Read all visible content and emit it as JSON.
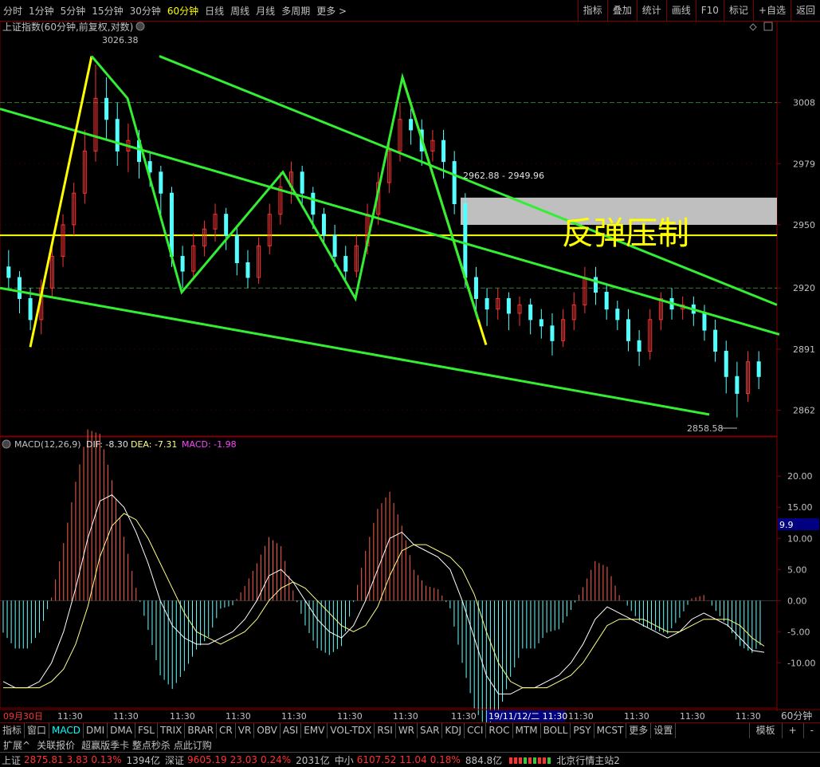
{
  "toolbar": {
    "timeframes": [
      "分时",
      "1分钟",
      "5分钟",
      "15分钟",
      "30分钟",
      "60分钟",
      "日线",
      "周线",
      "月线",
      "多周期",
      "更多 >"
    ],
    "active_timeframe": "60分钟",
    "right_buttons": [
      "指标",
      "叠加",
      "统计",
      "画线",
      "F10",
      "标记",
      "+自选",
      "返回"
    ]
  },
  "chart_title": "上证指数(60分钟,前复权,对数)",
  "annotation": {
    "text": "反弹压制",
    "range_label": "2962.88 - 2949.96",
    "high_label": "3026.38",
    "low_label": "2858.58"
  },
  "price_axis": [
    {
      "label": "3008",
      "value": 3008
    },
    {
      "label": "2979",
      "value": 2979
    },
    {
      "label": "2950",
      "value": 2950
    },
    {
      "label": "2920",
      "value": 2920
    },
    {
      "label": "2891",
      "value": 2891
    },
    {
      "label": "2862",
      "value": 2862
    }
  ],
  "macd": {
    "title": "MACD(12,26,9)",
    "dif_label": "DIF: -8.30",
    "dea_label": "DEA: -7.31",
    "macd_label": "MACD: -1.98",
    "axis": [
      {
        "label": "20.00",
        "value": 20
      },
      {
        "label": "15.00",
        "value": 15
      },
      {
        "label": "10.00",
        "value": 10
      },
      {
        "label": "5.00",
        "value": 5
      },
      {
        "label": "0.00",
        "value": 0
      },
      {
        "label": "-5.00",
        "value": -5
      },
      {
        "label": "-10.00",
        "value": -10
      }
    ],
    "cursor_value": "9.9"
  },
  "time_axis": {
    "labels": [
      "09月30日",
      "11:30",
      "11:30",
      "11:30",
      "11:30",
      "11:30",
      "11:30",
      "11:30",
      "11:30",
      "19/11/12/二 11:30",
      "11:30",
      "11:30",
      "11:30",
      "11:30"
    ],
    "period_label": "60分钟"
  },
  "chart_data": {
    "type": "candlestick",
    "title": "上证指数(60分钟,前复权,对数)",
    "ylim": [
      2852,
      3040
    ],
    "high": 3026.38,
    "low": 2858.58,
    "resistance_zone": [
      2949.96,
      2962.88
    ],
    "horizontal_level": 2945,
    "candles": [
      [
        2930,
        2925,
        2938,
        2920
      ],
      [
        2925,
        2915,
        2928,
        2908
      ],
      [
        2915,
        2905,
        2920,
        2900
      ],
      [
        2905,
        2920,
        2924,
        2898
      ],
      [
        2920,
        2935,
        2940,
        2916
      ],
      [
        2935,
        2950,
        2955,
        2930
      ],
      [
        2950,
        2965,
        2970,
        2945
      ],
      [
        2965,
        2985,
        2995,
        2960
      ],
      [
        2985,
        3010,
        3026,
        2980
      ],
      [
        3010,
        3000,
        3020,
        2990
      ],
      [
        3000,
        2985,
        3008,
        2978
      ],
      [
        2985,
        2990,
        2998,
        2975
      ],
      [
        2990,
        2980,
        2995,
        2972
      ],
      [
        2980,
        2975,
        2985,
        2968
      ],
      [
        2975,
        2965,
        2978,
        2955
      ],
      [
        2965,
        2935,
        2968,
        2930
      ],
      [
        2935,
        2928,
        2940,
        2920
      ],
      [
        2928,
        2940,
        2946,
        2925
      ],
      [
        2940,
        2948,
        2952,
        2935
      ],
      [
        2948,
        2955,
        2960,
        2942
      ],
      [
        2955,
        2945,
        2958,
        2938
      ],
      [
        2945,
        2932,
        2950,
        2926
      ],
      [
        2932,
        2925,
        2938,
        2920
      ],
      [
        2925,
        2940,
        2944,
        2922
      ],
      [
        2940,
        2955,
        2960,
        2936
      ],
      [
        2955,
        2968,
        2975,
        2950
      ],
      [
        2968,
        2975,
        2980,
        2960
      ],
      [
        2975,
        2965,
        2978,
        2958
      ],
      [
        2965,
        2955,
        2968,
        2948
      ],
      [
        2955,
        2945,
        2958,
        2940
      ],
      [
        2945,
        2935,
        2950,
        2930
      ],
      [
        2935,
        2928,
        2940,
        2924
      ],
      [
        2928,
        2940,
        2945,
        2925
      ],
      [
        2940,
        2955,
        2960,
        2936
      ],
      [
        2955,
        2970,
        2975,
        2950
      ],
      [
        2970,
        2985,
        2990,
        2965
      ],
      [
        2985,
        3000,
        3008,
        2980
      ],
      [
        3000,
        2995,
        3005,
        2988
      ],
      [
        2995,
        2985,
        3000,
        2978
      ],
      [
        2985,
        2990,
        2995,
        2980
      ],
      [
        2990,
        2980,
        2995,
        2972
      ],
      [
        2980,
        2960,
        2985,
        2955
      ],
      [
        2960,
        2925,
        2965,
        2920
      ],
      [
        2925,
        2915,
        2930,
        2908
      ],
      [
        2915,
        2910,
        2920,
        2902
      ],
      [
        2910,
        2915,
        2920,
        2905
      ],
      [
        2915,
        2908,
        2918,
        2900
      ],
      [
        2908,
        2912,
        2916,
        2902
      ],
      [
        2912,
        2905,
        2915,
        2898
      ],
      [
        2905,
        2902,
        2910,
        2896
      ],
      [
        2902,
        2895,
        2908,
        2888
      ],
      [
        2895,
        2905,
        2910,
        2892
      ],
      [
        2905,
        2912,
        2918,
        2900
      ],
      [
        2912,
        2925,
        2930,
        2908
      ],
      [
        2925,
        2918,
        2930,
        2912
      ],
      [
        2918,
        2910,
        2922,
        2905
      ],
      [
        2910,
        2905,
        2914,
        2900
      ],
      [
        2905,
        2895,
        2910,
        2890
      ],
      [
        2895,
        2890,
        2900,
        2883
      ],
      [
        2890,
        2905,
        2910,
        2886
      ],
      [
        2905,
        2915,
        2918,
        2900
      ],
      [
        2915,
        2910,
        2920,
        2905
      ],
      [
        2910,
        2912,
        2916,
        2905
      ],
      [
        2912,
        2908,
        2916,
        2902
      ],
      [
        2908,
        2900,
        2912,
        2895
      ],
      [
        2900,
        2890,
        2905,
        2885
      ],
      [
        2890,
        2878,
        2895,
        2870
      ],
      [
        2878,
        2870,
        2885,
        2858.58
      ],
      [
        2870,
        2885,
        2890,
        2866
      ],
      [
        2885,
        2878,
        2890,
        2872
      ]
    ],
    "green_lines": [
      {
        "name": "",
        "points": [
          [
            0,
            3005
          ],
          [
            978,
            2898
          ]
        ]
      },
      {
        "name": "",
        "points": [
          [
            200,
            3030
          ],
          [
            975,
            2912
          ]
        ]
      },
      {
        "name": "",
        "points": [
          [
            0,
            2920
          ],
          [
            890,
            2860
          ]
        ]
      }
    ],
    "zigzag_green": [
      [
        115,
        3030
      ],
      [
        160,
        3010
      ],
      [
        228,
        2918
      ],
      [
        355,
        2975
      ],
      [
        446,
        2915
      ],
      [
        505,
        3020
      ],
      [
        600,
        2905
      ]
    ],
    "zigzag_yellow": [
      [
        38,
        2892
      ],
      [
        115,
        3030
      ]
    ],
    "zigzag_yellow_2": [
      [
        505,
        3020
      ],
      [
        610,
        2893
      ]
    ],
    "macd_series": {
      "dif": [
        -13,
        -14,
        -14,
        -13,
        -10,
        -5,
        2,
        10,
        16,
        17,
        15,
        11,
        6,
        0,
        -4,
        -6,
        -7,
        -7,
        -6,
        -5,
        -3,
        0,
        4,
        5,
        3,
        0,
        -3,
        -5,
        -6,
        -4,
        0,
        5,
        10,
        11,
        9,
        8,
        7,
        5,
        0,
        -6,
        -12,
        -15,
        -15,
        -14,
        -14,
        -13,
        -12,
        -10,
        -7,
        -3,
        -1,
        -2,
        -3,
        -4,
        -5,
        -6,
        -5,
        -3,
        -2,
        -3,
        -4,
        -6,
        -8,
        -8.3
      ],
      "dea": [
        -14,
        -14,
        -14,
        -14,
        -13,
        -11,
        -7,
        -1,
        7,
        12,
        14,
        13,
        10,
        6,
        2,
        -2,
        -5,
        -6,
        -7,
        -6,
        -5,
        -3,
        0,
        2,
        3,
        2,
        0,
        -2,
        -4,
        -5,
        -4,
        -1,
        4,
        8,
        9,
        9,
        8,
        7,
        5,
        1,
        -5,
        -10,
        -13,
        -14,
        -14,
        -14,
        -13,
        -12,
        -10,
        -7,
        -4,
        -3,
        -3,
        -3,
        -4,
        -5,
        -5,
        -4,
        -3,
        -3,
        -3,
        -4,
        -6,
        -7.31
      ],
      "hist_estimate": [
        -1.98
      ]
    }
  },
  "tabs": [
    "指标",
    "窗口",
    "MACD",
    "DMI",
    "DMA",
    "FSL",
    "TRIX",
    "BRAR",
    "CR",
    "VR",
    "OBV",
    "ASI",
    "EMV",
    "VOL-TDX",
    "RSI",
    "WR",
    "SAR",
    "KDJ",
    "CCI",
    "ROC",
    "MTM",
    "BOLL",
    "PSY",
    "MCST",
    "更多",
    "设置"
  ],
  "active_tab": "MACD",
  "tabs_right": [
    "模板",
    "+",
    "-"
  ],
  "ext_bar": [
    "扩展^",
    "关联报价",
    "超赢版季卡 整点秒杀 点此订购"
  ],
  "status": {
    "sh_label": "上证",
    "sh_value": "2875.81",
    "sh_change": "3.83",
    "sh_pct": "0.13%",
    "sh_amount": "1394亿",
    "sz_label": "深证",
    "sz_value": "9605.19",
    "sz_change": "23.03",
    "sz_pct": "0.24%",
    "sz_amount": "2031亿",
    "zx_label": "中小",
    "zx_value": "6107.52",
    "zx_change": "11.04",
    "zx_pct": "0.18%",
    "zx_amount": "884.8亿",
    "server": "北京行情主站2"
  },
  "colors": {
    "up": "#ff3232",
    "down": "#54ffff",
    "green_line": "#33ee33",
    "yellow_line": "#ffff00",
    "grid": "#800000",
    "dotted": "#3a7a3a"
  }
}
